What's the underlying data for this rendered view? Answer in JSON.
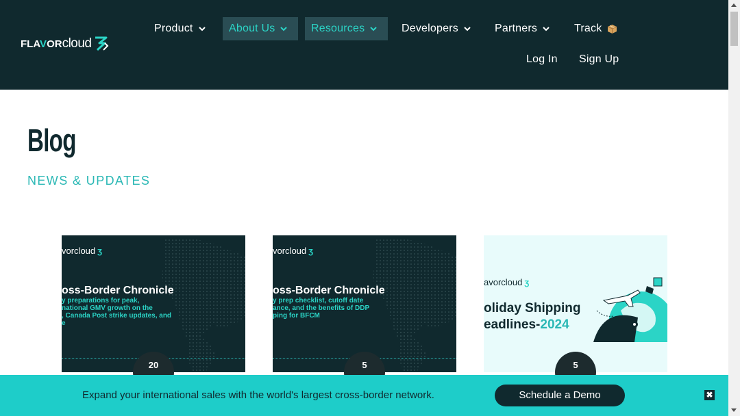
{
  "header": {
    "logo": {
      "part1": "FLA",
      "o": "V",
      "part2": "OR",
      "part3": "cloud"
    },
    "nav": [
      {
        "label": "Product"
      },
      {
        "label": "About Us"
      },
      {
        "label": "Resources"
      },
      {
        "label": "Developers"
      },
      {
        "label": "Partners"
      },
      {
        "label": "Track"
      }
    ],
    "login": "Log In",
    "signup": "Sign Up"
  },
  "main": {
    "title": "Blog",
    "subtitle": "NEWS & UPDATES",
    "cards": [
      {
        "logo": "vorcloud",
        "title": "oss-Border Chronicle",
        "sub": "y preparations for peak,\nnational GMV growth on the\n, Canada Post strike updates, and\ne",
        "badge": "20"
      },
      {
        "logo": "vorcloud",
        "title": "oss-Border Chronicle",
        "sub": "y prep checklist, cutoff date\nance, and the benefits of DDP\nping for BFCM",
        "badge": "5"
      },
      {
        "logo": "avorcloud",
        "title_line1": "oliday Shipping",
        "title_line2": "eadlines-",
        "title_year": "2024",
        "badge": "5"
      }
    ]
  },
  "banner": {
    "text": "Expand your international sales with the world's largest cross-border network.",
    "button": "Schedule a Demo",
    "close": "✖"
  },
  "colors": {
    "header_bg": "#10292e",
    "accent": "#2bd4c6",
    "banner_bg": "#1ecdc9"
  }
}
